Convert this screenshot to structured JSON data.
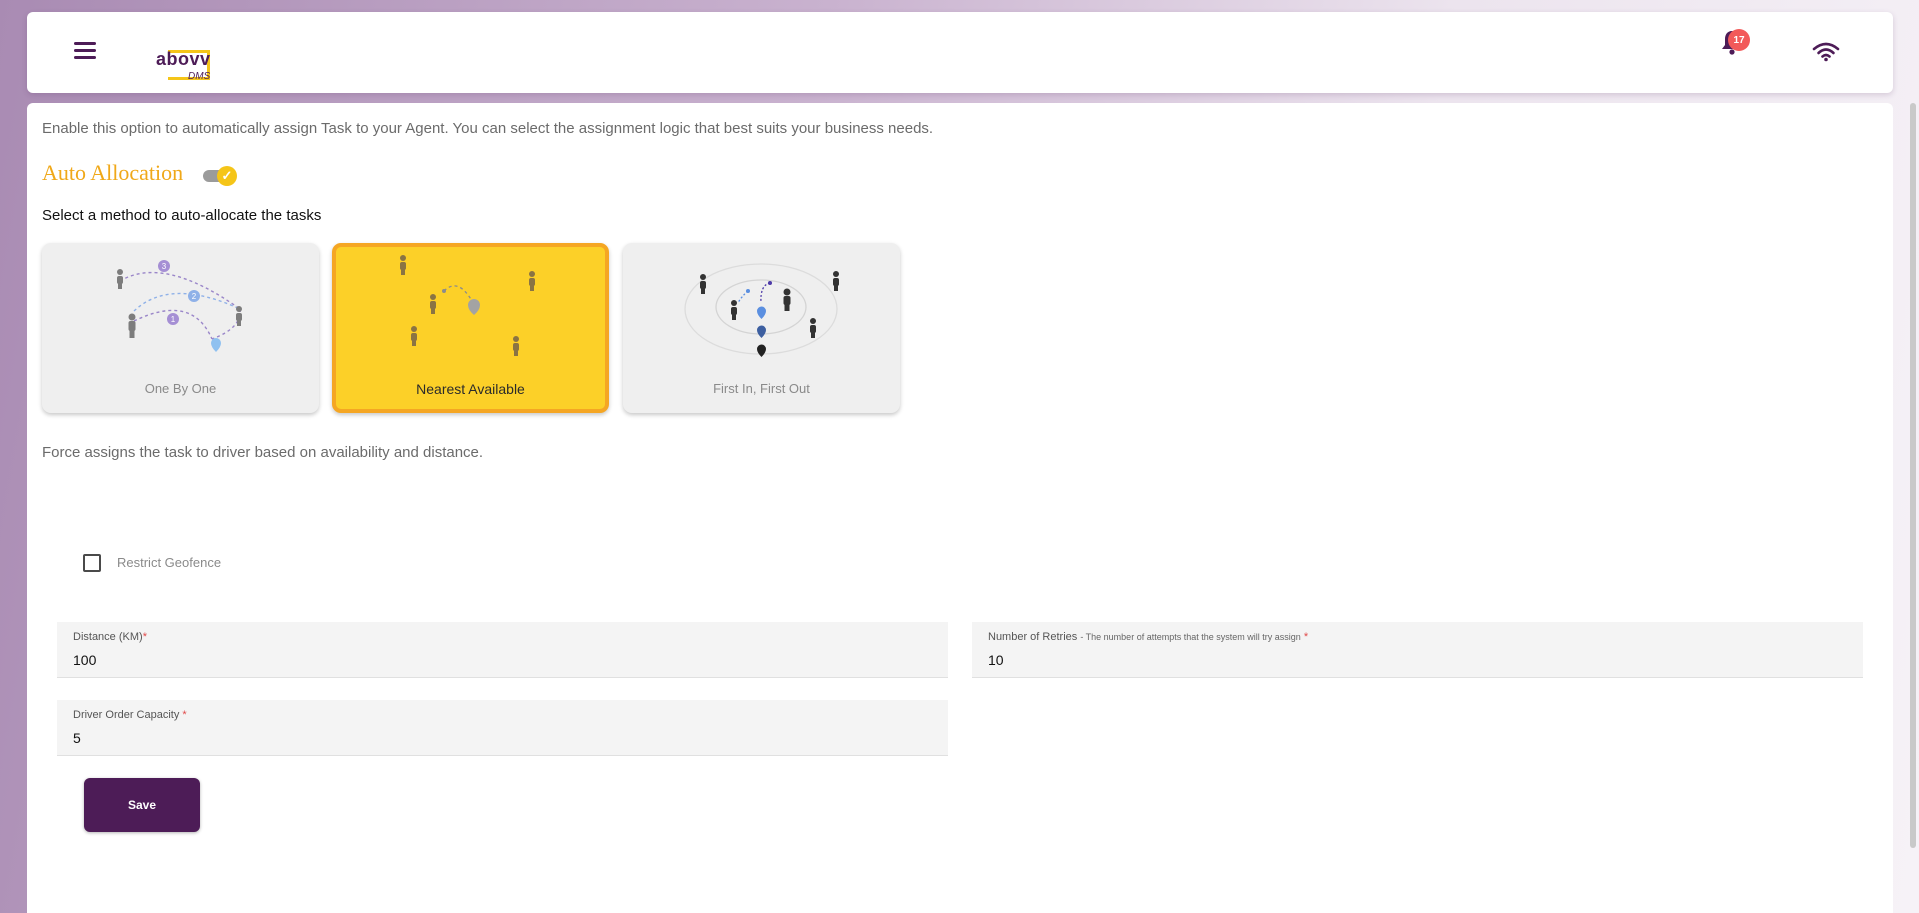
{
  "header": {
    "logo_main": "abovv",
    "logo_sub": "DMS",
    "notification_count": "17"
  },
  "intro": "Enable this option to automatically assign Task to your Agent. You can select the assignment logic that best suits your business needs.",
  "auto_allocation": {
    "title": "Auto Allocation",
    "enabled": true,
    "select_label": "Select a method to auto-allocate the tasks",
    "methods": [
      {
        "label": "One By One",
        "selected": false
      },
      {
        "label": "Nearest Available",
        "selected": true
      },
      {
        "label": "First In, First Out",
        "selected": false
      }
    ],
    "description": "Force assigns the task to driver based on availability and distance."
  },
  "restrict_geofence": {
    "label": "Restrict Geofence",
    "checked": false
  },
  "fields": {
    "distance": {
      "label": "Distance (KM)",
      "value": "100"
    },
    "retries": {
      "label": "Number of Retries",
      "hint": "- The number of attempts that the system will try assign",
      "value": "10"
    },
    "capacity": {
      "label": "Driver Order Capacity",
      "value": "5"
    }
  },
  "save_label": "Save",
  "colors": {
    "brand": "#4d1c57",
    "accent": "#f5c518",
    "selected_card": "#fcd028",
    "badge": "#f25a5a"
  }
}
